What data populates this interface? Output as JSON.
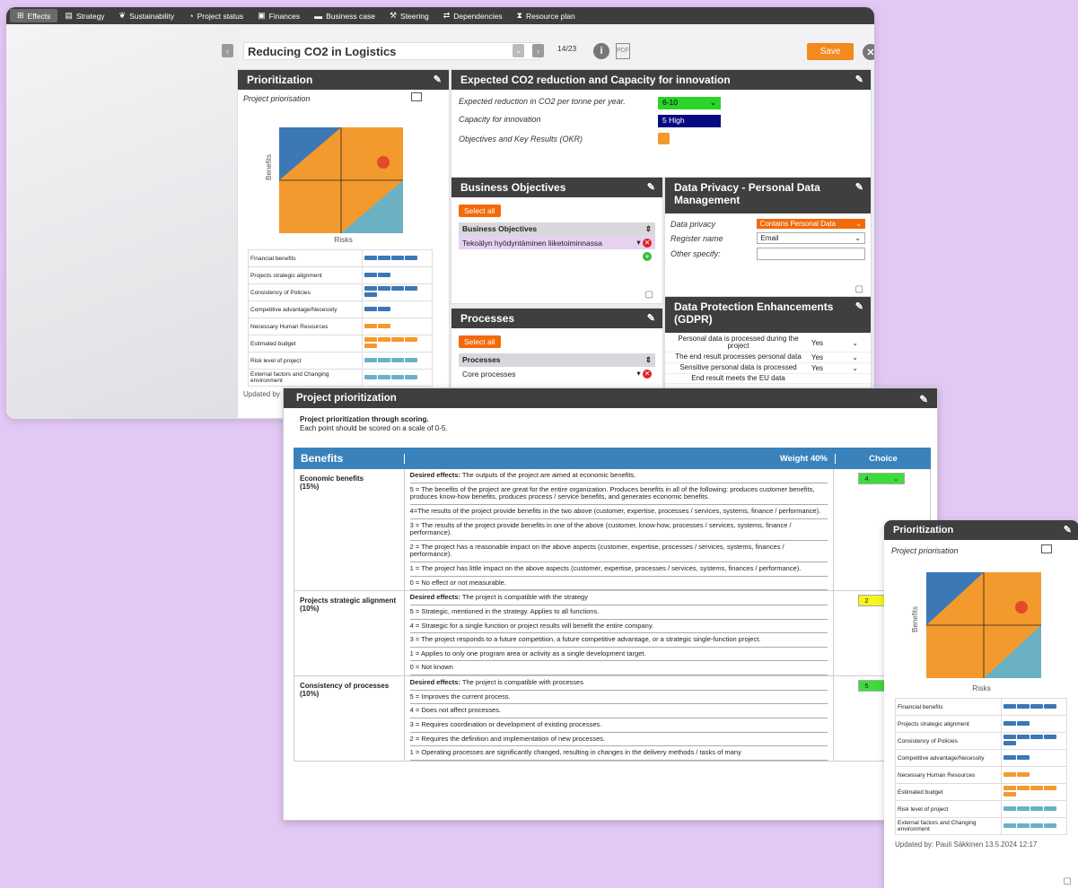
{
  "nav": {
    "tabs": [
      {
        "label": "Effects",
        "icon": "grid-icon"
      },
      {
        "label": "Strategy",
        "icon": "list-icon"
      },
      {
        "label": "Sustainability",
        "icon": "leaf-icon"
      },
      {
        "label": "Project status",
        "icon": "dashboard-icon"
      },
      {
        "label": "Finances",
        "icon": "money-icon"
      },
      {
        "label": "Business case",
        "icon": "briefcase-icon"
      },
      {
        "label": "Steering",
        "icon": "gavel-icon"
      },
      {
        "label": "Dependencies",
        "icon": "arrows-icon"
      },
      {
        "label": "Resource plan",
        "icon": "hourglass-icon"
      }
    ]
  },
  "header": {
    "project_title": "Reducing CO2 in Logistics",
    "counter": "14/23",
    "save_label": "Save"
  },
  "prioritization": {
    "title": "Prioritization",
    "subtitle": "Project priorisation",
    "y_axis": "Benefits",
    "x_axis": "Risks",
    "rows": [
      {
        "label": "Financial benefits",
        "color": "#3b78b5",
        "level": 4
      },
      {
        "label": "Projects strategic alignment",
        "color": "#3b78b5",
        "level": 2
      },
      {
        "label": "Consistency of Policies",
        "color": "#3b78b5",
        "level": 5
      },
      {
        "label": "Competitive advantage/Necessity",
        "color": "#3b78b5",
        "level": 2
      },
      {
        "label": "Necessary Human Resources",
        "color": "#f29a2e",
        "level": 2
      },
      {
        "label": "Estimated budget",
        "color": "#f29a2e",
        "level": 5
      },
      {
        "label": "Risk level of project",
        "color": "#6ab2c3",
        "level": 4
      },
      {
        "label": "External factors and Changing environment",
        "color": "#6ab2c3",
        "level": 4
      }
    ],
    "updated_short": "Updated by",
    "updated_full": "Updated by: Pauli Säkkinen 13.5.2024 12:17"
  },
  "co2": {
    "title": "Expected CO2 reduction and Capacity for innovation",
    "reduction_label": "Expected reduction in CO2 per tonne per year.",
    "reduction_value": "6-10",
    "capacity_label": "Capacity for innovation",
    "capacity_value": "5 High",
    "okr_label": "Objectives and Key Results (OKR)"
  },
  "business_objectives": {
    "title": "Business Objectives",
    "select_all": "Select all",
    "column": "Business Objectives",
    "row": "Tekoälyn hyödyntäminen liiketoiminnassa"
  },
  "processes": {
    "title": "Processes",
    "select_all": "Select all",
    "column": "Processes",
    "row": "Core processes"
  },
  "data_privacy": {
    "title": "Data Privacy - Personal Data Management",
    "privacy_label": "Data privacy",
    "privacy_value": "Contains Personal Data",
    "register_label": "Register name",
    "register_value": "Email",
    "other_label": "Other specify:"
  },
  "gdpr": {
    "title": "Data Protection Enhancements (GDPR)",
    "rows": [
      {
        "label": "Personal data is processed during the project",
        "value": "Yes"
      },
      {
        "label": "The end result processes personal data",
        "value": "Yes"
      },
      {
        "label": "Sensitive personal data is processed",
        "value": "Yes"
      },
      {
        "label": "End result meets the EU data",
        "value": ""
      }
    ]
  },
  "scoring": {
    "title": "Project prioritization",
    "intro1": "Project prioritization through scoring.",
    "intro2": "Each point should be scored on a scale of 0-5.",
    "header_benefits": "Benefits",
    "header_weight": "Weight 40%",
    "header_choice": "Choice",
    "criteria": [
      {
        "name": "Economic benefits",
        "weight": "(15%)",
        "choice": "4",
        "choice_color": "#3ddc3d",
        "desired": "The outputs of the project are aimed at economic benefits.",
        "items": [
          "5 = The benefits of the project are great for the entire organization. Produces benefits in all of the following: produces customer benefits, produces know-how benefits, produces process / service benefits, and generates economic benefits.",
          "4=The results of the project provide benefits in the two above (customer, expertise, processes / services, systems, finance / performance).",
          "3 = The results of the project provide benefits in one of the above (customer, know-how, processes / services, systems, finance / performance).",
          "2 = The project has a reasonable impact on the above aspects (customer, expertise, processes / services, systems, finances / performance).",
          "1 = The project has little impact on the above aspects (customer, expertise, processes / services, systems, finances / performance).",
          "0 = No effect or not measurable."
        ]
      },
      {
        "name": "Projects strategic alignment",
        "weight": "(10%)",
        "choice": "2",
        "choice_color": "#f5f520",
        "desired": "The project is compatible with the strategy",
        "items": [
          "5 = Strategic, mentioned in the strategy. Applies to all functions.",
          "4 = Strategic for a single function or project results will benefit the entire company.",
          "3 = The project responds to a future competition, a future competitive advantage, or a strategic single-function project.",
          "1 = Applies to only one program area or activity as a single development target.",
          "0 = Not known"
        ]
      },
      {
        "name": "Consistency of processes",
        "weight": "(10%)",
        "choice": "5",
        "choice_color": "#3ddc3d",
        "desired": "The project is compatible with processes",
        "items": [
          "5 = Improves the current process.",
          "4 = Does not affect processes.",
          "3 = Requires coordination or development of existing processes.",
          "2 = Requires the definition and implementation of new processes.",
          "1 = Operating processes are significantly changed, resulting in changes in the delivery methods / tasks of many"
        ]
      }
    ],
    "desired_prefix": "Desired effects:"
  }
}
